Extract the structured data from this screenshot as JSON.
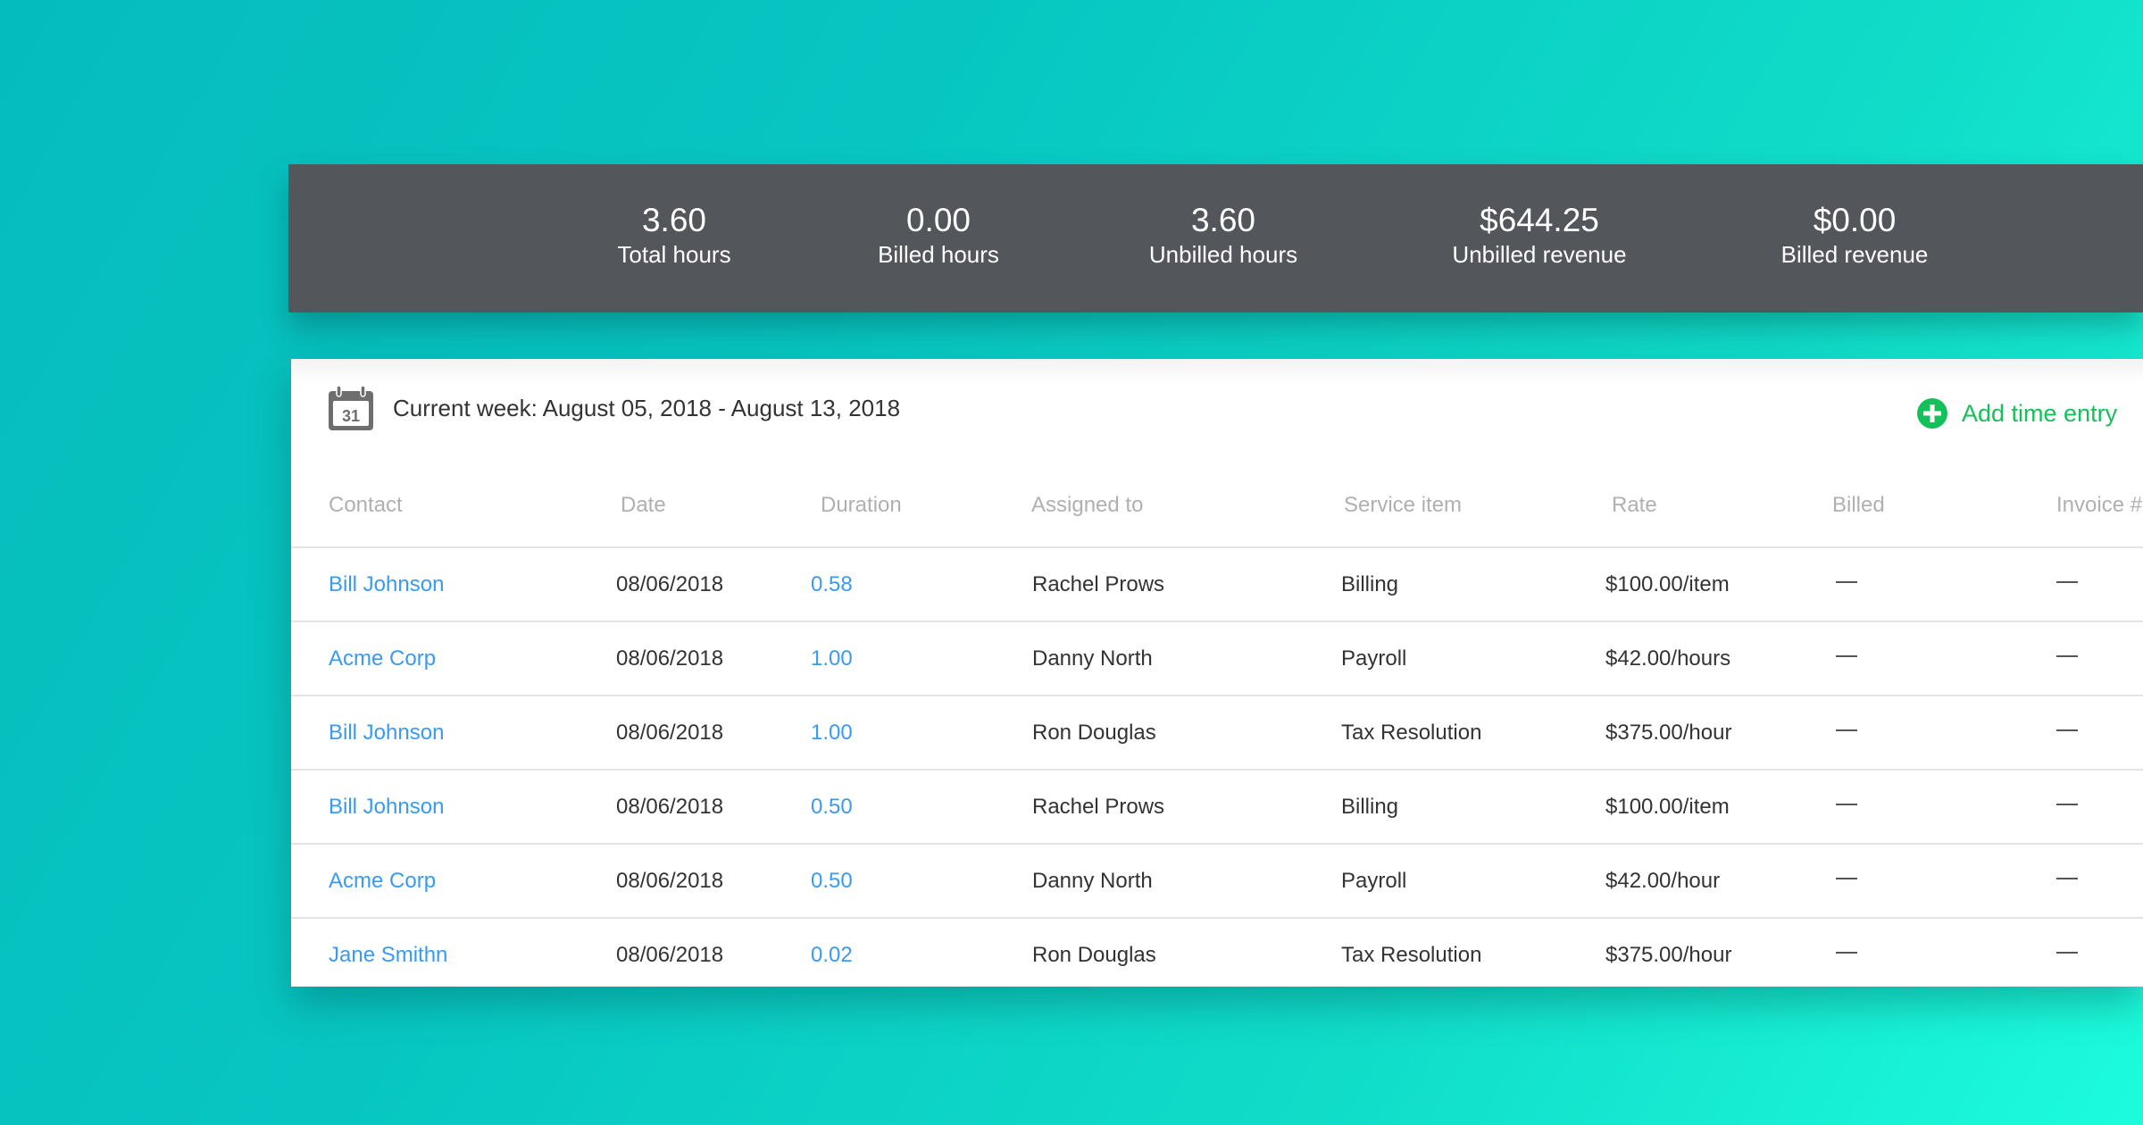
{
  "stats": [
    {
      "value": "3.60",
      "label": "Total hours"
    },
    {
      "value": "0.00",
      "label": "Billed hours"
    },
    {
      "value": "3.60",
      "label": "Unbilled hours"
    },
    {
      "value": "$644.25",
      "label": "Unbilled revenue"
    },
    {
      "value": "$0.00",
      "label": "Billed revenue"
    }
  ],
  "header": {
    "calendar_icon": "calendar-icon",
    "calendar_day": "31",
    "week_label": "Current week: August 05, 2018 - August 13, 2018",
    "add_entry_icon": "plus-circle-icon",
    "add_entry_label": "Add time entry"
  },
  "colors": {
    "accent_green": "#14c05a",
    "link_blue": "#3a9af0",
    "panel_dark": "#53565b"
  },
  "table": {
    "columns": [
      "Contact",
      "Date",
      "Duration",
      "Assigned to",
      "Service item",
      "Rate",
      "Billed",
      "Invoice #"
    ],
    "rows": [
      {
        "contact": "Bill Johnson",
        "date": "08/06/2018",
        "duration": "0.58",
        "assigned": "Rachel Prows",
        "service": "Billing",
        "rate": "$100.00/item",
        "billed": "—",
        "invoice": "—"
      },
      {
        "contact": "Acme Corp",
        "date": "08/06/2018",
        "duration": "1.00",
        "assigned": "Danny North",
        "service": "Payroll",
        "rate": "$42.00/hours",
        "billed": "—",
        "invoice": "—"
      },
      {
        "contact": "Bill Johnson",
        "date": "08/06/2018",
        "duration": "1.00",
        "assigned": "Ron Douglas",
        "service": "Tax Resolution",
        "rate": "$375.00/hour",
        "billed": "—",
        "invoice": "—"
      },
      {
        "contact": "Bill Johnson",
        "date": "08/06/2018",
        "duration": "0.50",
        "assigned": "Rachel Prows",
        "service": "Billing",
        "rate": "$100.00/item",
        "billed": "—",
        "invoice": "—"
      },
      {
        "contact": "Acme Corp",
        "date": "08/06/2018",
        "duration": "0.50",
        "assigned": "Danny North",
        "service": "Payroll",
        "rate": "$42.00/hour",
        "billed": "—",
        "invoice": "—"
      },
      {
        "contact": "Jane Smithn",
        "date": "08/06/2018",
        "duration": "0.02",
        "assigned": "Ron Douglas",
        "service": "Tax Resolution",
        "rate": "$375.00/hour",
        "billed": "—",
        "invoice": "—"
      }
    ]
  }
}
